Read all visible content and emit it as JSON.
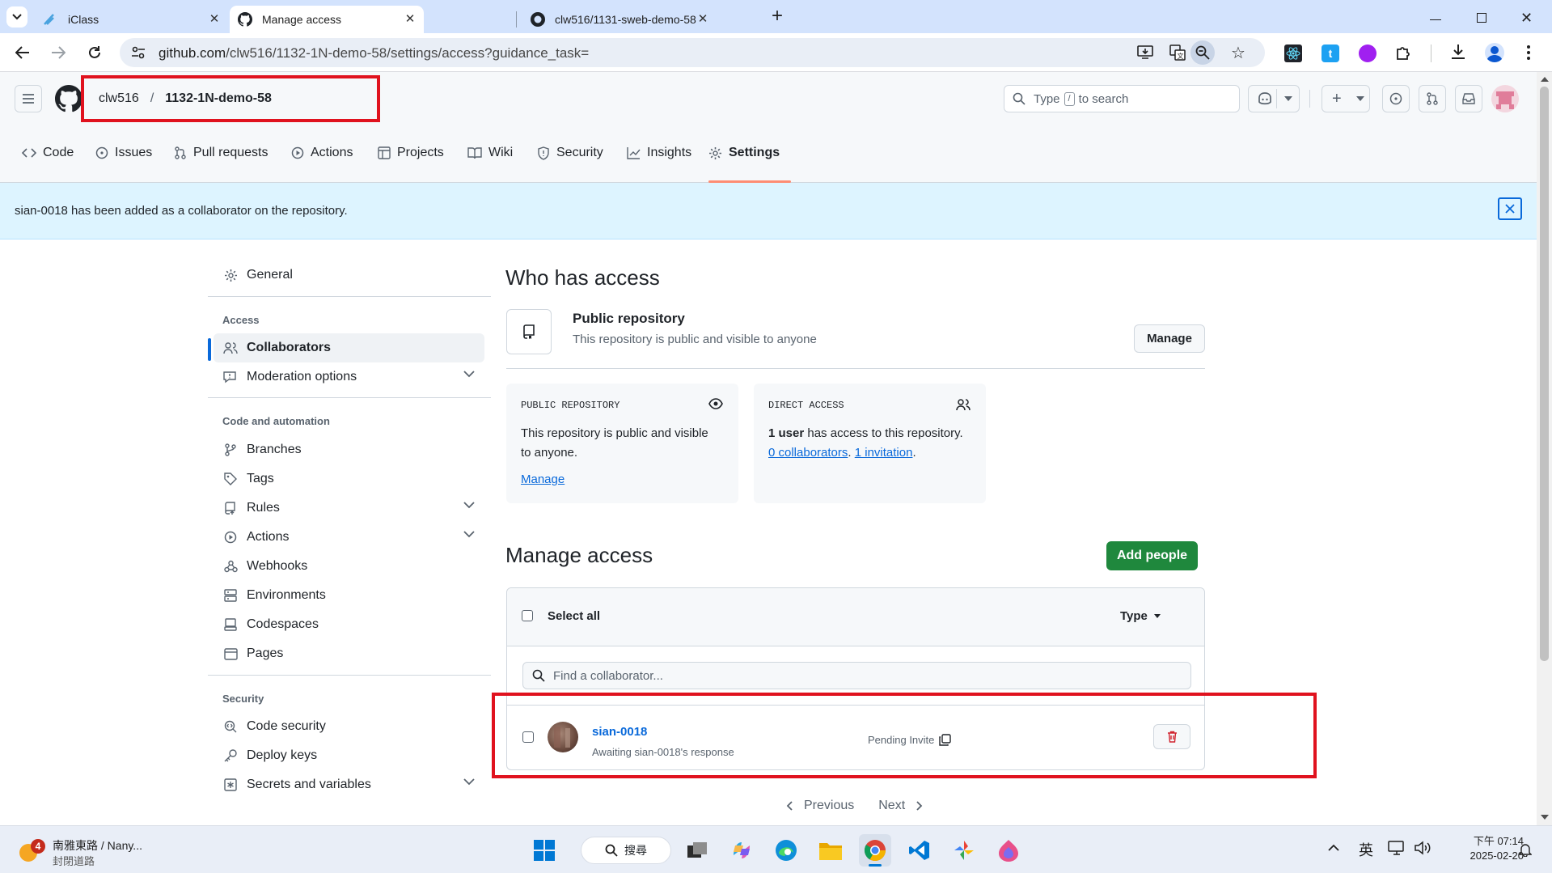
{
  "browser": {
    "tabs": [
      {
        "title": "iClass"
      },
      {
        "title": "Manage access"
      },
      {
        "title": "clw516/1131-sweb-demo-58"
      }
    ],
    "url_host": "github.com",
    "url_path": "/clw516/1132-1N-demo-58/settings/access?guidance_task="
  },
  "header": {
    "owner": "clw516",
    "separator": "/",
    "repo": "1132-1N-demo-58",
    "search_prefix": "Type",
    "search_key": "/",
    "search_suffix": "to search",
    "highlight_color": "#e0121e"
  },
  "nav": {
    "tabs": [
      {
        "label": "Code"
      },
      {
        "label": "Issues"
      },
      {
        "label": "Pull requests"
      },
      {
        "label": "Actions"
      },
      {
        "label": "Projects"
      },
      {
        "label": "Wiki"
      },
      {
        "label": "Security"
      },
      {
        "label": "Insights"
      },
      {
        "label": "Settings"
      }
    ],
    "active": "Settings",
    "accent": "#fd8c73"
  },
  "banner": {
    "text": "sian-0018 has been added as a collaborator on the repository."
  },
  "sidebar": {
    "general": "General",
    "access_heading": "Access",
    "collaborators": "Collaborators",
    "moderation": "Moderation options",
    "automation_heading": "Code and automation",
    "branches": "Branches",
    "tags": "Tags",
    "rules": "Rules",
    "actions": "Actions",
    "webhooks": "Webhooks",
    "environments": "Environments",
    "codespaces": "Codespaces",
    "pages": "Pages",
    "security_heading": "Security",
    "code_security": "Code security",
    "deploy_keys": "Deploy keys",
    "secrets": "Secrets and variables"
  },
  "main": {
    "who_title": "Who has access",
    "public_title": "Public repository",
    "public_desc": "This repository is public and visible to anyone",
    "manage_button": "Manage",
    "card1": {
      "heading": "PUBLIC REPOSITORY",
      "text_line1": "This repository is public and visible",
      "text_line2": "to anyone.",
      "link": "Manage"
    },
    "card2": {
      "heading": "DIRECT ACCESS",
      "count": "1 user",
      "text": "has access to this repository.",
      "collaborators_link": "0 collaborators",
      "sep": ".",
      "invitation_link": "1 invitation",
      "end": "."
    },
    "manage_title": "Manage access",
    "add_people": "Add people",
    "select_all": "Select all",
    "type_filter": "Type",
    "find_placeholder": "Find a collaborator...",
    "collaborator": {
      "username": "sian-0018",
      "status": "Awaiting sian-0018's response",
      "badge": "Pending Invite"
    },
    "pagination": {
      "previous": "Previous",
      "next": "Next"
    }
  },
  "taskbar": {
    "weather_badge": "4",
    "news_title": "南雅東路 / Nany...",
    "news_sub": "封閉道路",
    "search_label": "搜尋",
    "ime": "英",
    "time": "下午 07:14",
    "date": "2025-02-20"
  }
}
